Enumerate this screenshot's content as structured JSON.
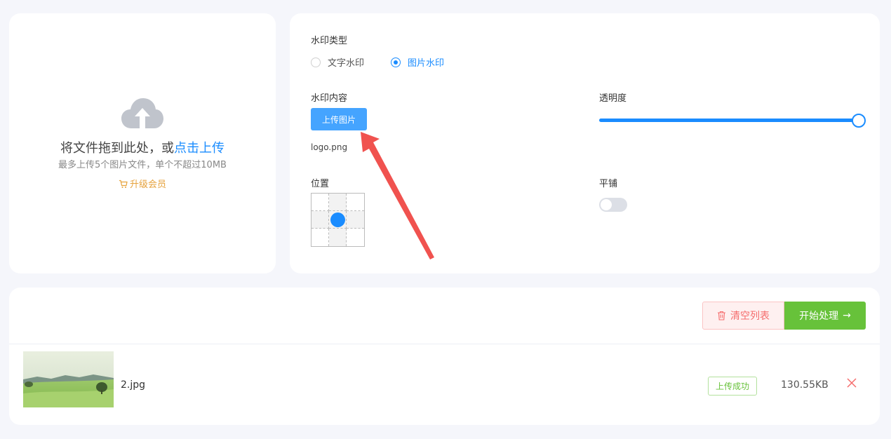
{
  "upload": {
    "drag_text": "将文件拖到此处，或",
    "click_text": "点击上传",
    "limit_text": "最多上传5个图片文件，单个不超过10MB",
    "upgrade_label": "升级会员"
  },
  "settings": {
    "type_label": "水印类型",
    "type_options": [
      {
        "label": "文字水印",
        "selected": false
      },
      {
        "label": "图片水印",
        "selected": true
      }
    ],
    "content_label": "水印内容",
    "upload_image_label": "上传图片",
    "uploaded_file": "logo.png",
    "opacity_label": "透明度",
    "opacity_value": 1.0,
    "position_label": "位置",
    "position_selected": "center",
    "tile_label": "平铺",
    "tile_enabled": false
  },
  "list": {
    "clear_label": "清空列表",
    "start_label": "开始处理",
    "items": [
      {
        "name": "2.jpg",
        "status": "上传成功",
        "size": "130.55KB"
      }
    ]
  },
  "colors": {
    "primary": "#1a8cff",
    "success": "#67c23a",
    "danger": "#f56c6c",
    "warning": "#e6a23c"
  }
}
